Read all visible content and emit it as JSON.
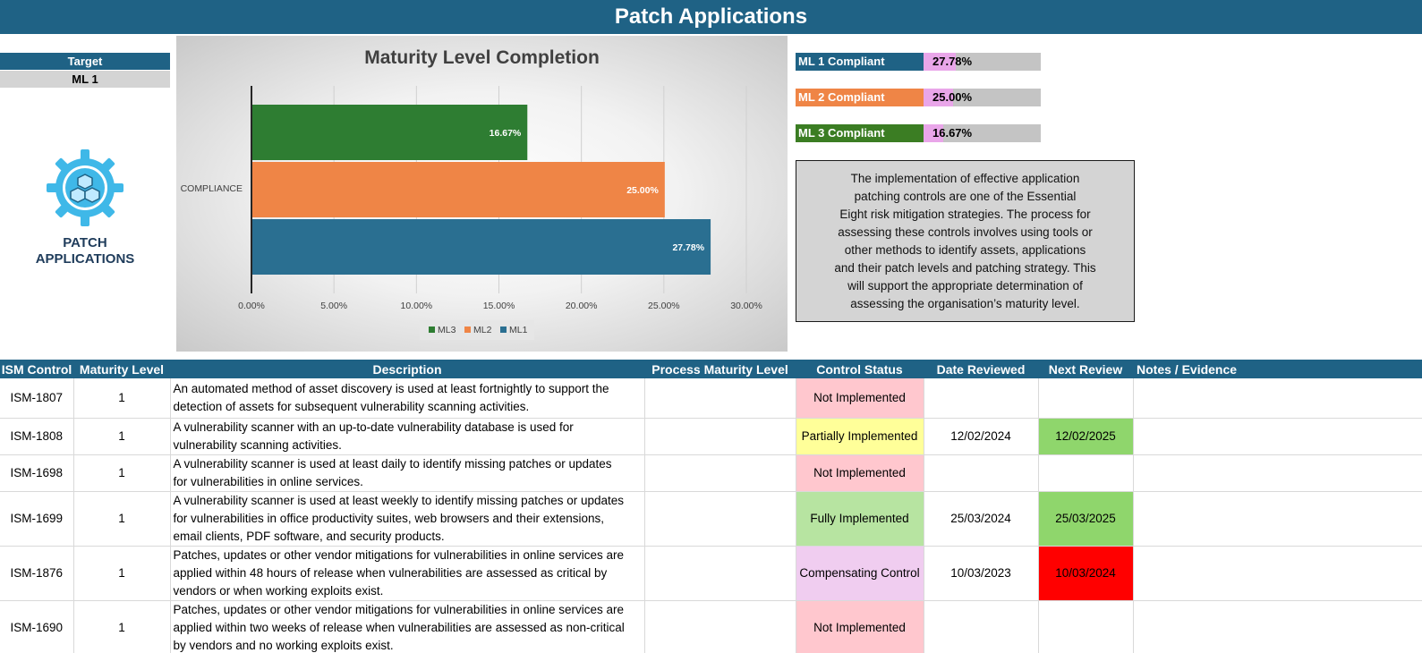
{
  "header": {
    "title": "Patch Applications"
  },
  "target": {
    "label": "Target",
    "value": "ML 1"
  },
  "logo": {
    "icon": "gear-cubes-icon",
    "line1": "PATCH",
    "line2": "APPLICATIONS"
  },
  "chart_data": {
    "type": "bar",
    "orientation": "horizontal",
    "title": "Maturity Level Completion",
    "categories": [
      "COMPLIANCE"
    ],
    "series": [
      {
        "name": "ML3",
        "values": [
          16.67
        ],
        "label": "16.67%",
        "color": "#2e7d32"
      },
      {
        "name": "ML2",
        "values": [
          25.0
        ],
        "label": "25.00%",
        "color": "#ef8546"
      },
      {
        "name": "ML1",
        "values": [
          27.78
        ],
        "label": "27.78%",
        "color": "#2a6f91"
      }
    ],
    "xlim": [
      0,
      30
    ],
    "xticks": [
      "0.00%",
      "5.00%",
      "10.00%",
      "15.00%",
      "20.00%",
      "25.00%",
      "30.00%"
    ],
    "grid": true,
    "legend_position": "bottom"
  },
  "compliance": [
    {
      "label": "ML 1 Compliant",
      "value": "27.78%",
      "percent": 27.78,
      "color": "#1f6285"
    },
    {
      "label": "ML 2 Compliant",
      "value": "25.00%",
      "percent": 25.0,
      "color": "#ef8546"
    },
    {
      "label": "ML 3 Compliant",
      "value": "16.67%",
      "percent": 16.67,
      "color": "#3b7d23"
    }
  ],
  "info": {
    "lines": [
      "The implementation of effective application",
      "patching controls are one of the Essential",
      "Eight risk mitigation strategies. The process for",
      "assessing these controls involves using tools or",
      "other methods to identify assets, applications",
      "and their patch levels and patching strategy. This",
      "will support the appropriate determination of",
      "assessing the organisation’s maturity level."
    ]
  },
  "table": {
    "headers": [
      "ISM Control",
      "Maturity Level",
      "Description",
      "Process Maturity Level",
      "Control Status",
      "Date Reviewed",
      "Next Review",
      "Notes / Evidence"
    ],
    "rows": [
      {
        "control": "ISM-1807",
        "level": "1",
        "desc": [
          "An automated method of asset discovery is used at least fortnightly to support the",
          "detection of assets for subsequent vulnerability scanning activities."
        ],
        "process": "",
        "status": "Not Implemented",
        "status_class": "st-not",
        "reviewed": "",
        "next": "",
        "next_class": "",
        "notes": ""
      },
      {
        "control": "ISM-1808",
        "level": "1",
        "desc": [
          "A vulnerability scanner with an up-to-date vulnerability database is used for",
          "vulnerability scanning activities."
        ],
        "process": "",
        "status": "Partially Implemented",
        "status_class": "st-part",
        "reviewed": "12/02/2024",
        "next": "12/02/2025",
        "next_class": "nr-green",
        "notes": ""
      },
      {
        "control": "ISM-1698",
        "level": "1",
        "desc": [
          "A vulnerability scanner is used at least daily to identify missing patches or updates",
          "for vulnerabilities in online services."
        ],
        "process": "",
        "status": "Not Implemented",
        "status_class": "st-not",
        "reviewed": "",
        "next": "",
        "next_class": "",
        "notes": ""
      },
      {
        "control": "ISM-1699",
        "level": "1",
        "desc": [
          "A vulnerability scanner is used at least weekly to identify missing patches or updates",
          "for vulnerabilities in office productivity suites, web browsers and their extensions,",
          "email clients, PDF software, and security products."
        ],
        "process": "",
        "status": "Fully Implemented",
        "status_class": "st-full",
        "reviewed": "25/03/2024",
        "next": "25/03/2025",
        "next_class": "nr-green",
        "notes": ""
      },
      {
        "control": "ISM-1876",
        "level": "1",
        "desc": [
          "Patches, updates or other vendor mitigations for vulnerabilities in online services are",
          "applied within 48 hours of release when vulnerabilities are assessed as critical by",
          "vendors or when working exploits exist."
        ],
        "process": "",
        "status": "Compensating Control",
        "status_class": "st-comp",
        "reviewed": "10/03/2023",
        "next": "10/03/2024",
        "next_class": "nr-red",
        "notes": ""
      },
      {
        "control": "ISM-1690",
        "level": "1",
        "desc": [
          "Patches, updates or other vendor mitigations for vulnerabilities in online services are",
          "applied within two weeks of release when vulnerabilities are assessed as non-critical",
          "by vendors and no working exploits exist."
        ],
        "process": "",
        "status": "Not Implemented",
        "status_class": "st-not",
        "reviewed": "",
        "next": "",
        "next_class": "",
        "notes": ""
      }
    ]
  }
}
